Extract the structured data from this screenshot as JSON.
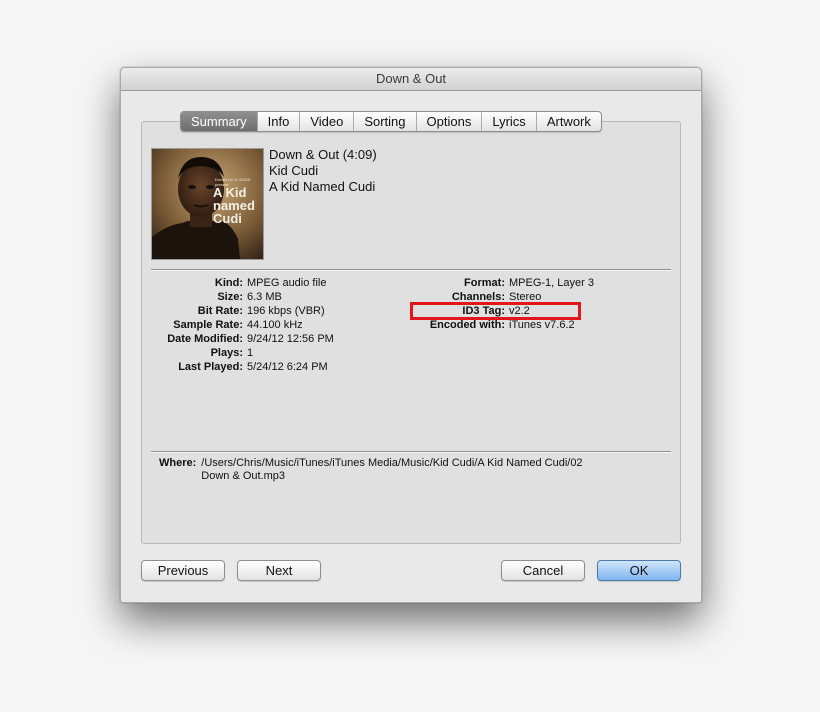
{
  "window": {
    "title": "Down & Out"
  },
  "tabs": [
    "Summary",
    "Info",
    "Video",
    "Sorting",
    "Options",
    "Lyrics",
    "Artwork"
  ],
  "active_tab": "Summary",
  "artwork": {
    "small_text": "Dream On & GOOD present",
    "title_line1": "A Kid",
    "title_line2": "named",
    "title_line3": "Cudi"
  },
  "track": {
    "title_line": "Down & Out (4:09)",
    "artist": "Kid Cudi",
    "album": "A Kid Named Cudi"
  },
  "left_fields": [
    {
      "label": "Kind:",
      "value": "MPEG audio file"
    },
    {
      "label": "Size:",
      "value": "6.3 MB"
    },
    {
      "label": "Bit Rate:",
      "value": "196 kbps (VBR)"
    },
    {
      "label": "Sample Rate:",
      "value": "44.100 kHz"
    },
    {
      "label": "Date Modified:",
      "value": "9/24/12 12:56 PM"
    },
    {
      "label": "Plays:",
      "value": "1"
    },
    {
      "label": "Last Played:",
      "value": "5/24/12 6:24 PM"
    }
  ],
  "right_fields": [
    {
      "label": "Format:",
      "value": "MPEG-1, Layer 3"
    },
    {
      "label": "Channels:",
      "value": "Stereo"
    },
    {
      "label": "ID3 Tag:",
      "value": "v2.2"
    },
    {
      "label": "Encoded with:",
      "value": "iTunes v7.6.2"
    }
  ],
  "where": {
    "label": "Where:",
    "line1": "/Users/Chris/Music/iTunes/iTunes Media/Music/Kid Cudi/A Kid Named Cudi/02",
    "line2": "Down & Out.mp3"
  },
  "buttons": {
    "previous": "Previous",
    "next": "Next",
    "cancel": "Cancel",
    "ok": "OK"
  },
  "colors": {
    "highlight_box": "#e3141a",
    "ok_button": "#7fb5ef",
    "active_tab": "#7a7a7a"
  }
}
